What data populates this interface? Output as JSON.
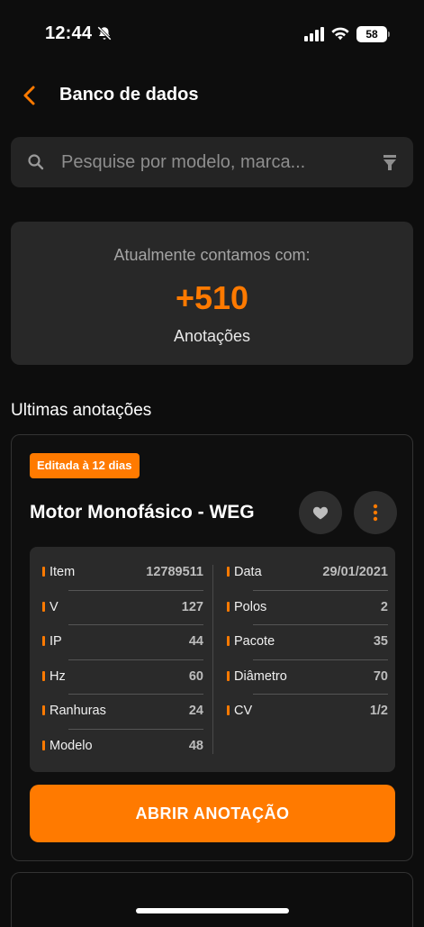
{
  "status_bar": {
    "time": "12:44",
    "battery": "58"
  },
  "header": {
    "title": "Banco de dados"
  },
  "search": {
    "placeholder": "Pesquise por modelo, marca..."
  },
  "stats": {
    "caption": "Atualmente contamos com:",
    "count": "+510",
    "label": "Anotações"
  },
  "section_title": "Ultimas anotações",
  "card": {
    "badge": "Editada à 12 dias",
    "title": "Motor Monofásico - WEG",
    "left_rows": [
      {
        "key": "Item",
        "value": "12789511"
      },
      {
        "key": "V",
        "value": "127"
      },
      {
        "key": "IP",
        "value": "44"
      },
      {
        "key": "Hz",
        "value": "60"
      },
      {
        "key": "Ranhuras",
        "value": "24"
      },
      {
        "key": "Modelo",
        "value": "48"
      }
    ],
    "right_rows": [
      {
        "key": "Data",
        "value": "29/01/2021"
      },
      {
        "key": "Polos",
        "value": "2"
      },
      {
        "key": "Pacote",
        "value": "35"
      },
      {
        "key": "Diâmetro",
        "value": "70"
      },
      {
        "key": "CV",
        "value": "1/2"
      }
    ],
    "open_button": "ABRIR ANOTAÇÃO"
  },
  "colors": {
    "accent": "#ff7a00",
    "background": "#0d0d0d",
    "surface": "#282828"
  },
  "icons": [
    "bell-off-icon",
    "signal-icon",
    "wifi-icon",
    "chevron-left-icon",
    "search-icon",
    "filter-icon",
    "heart-icon",
    "more-vertical-icon"
  ]
}
